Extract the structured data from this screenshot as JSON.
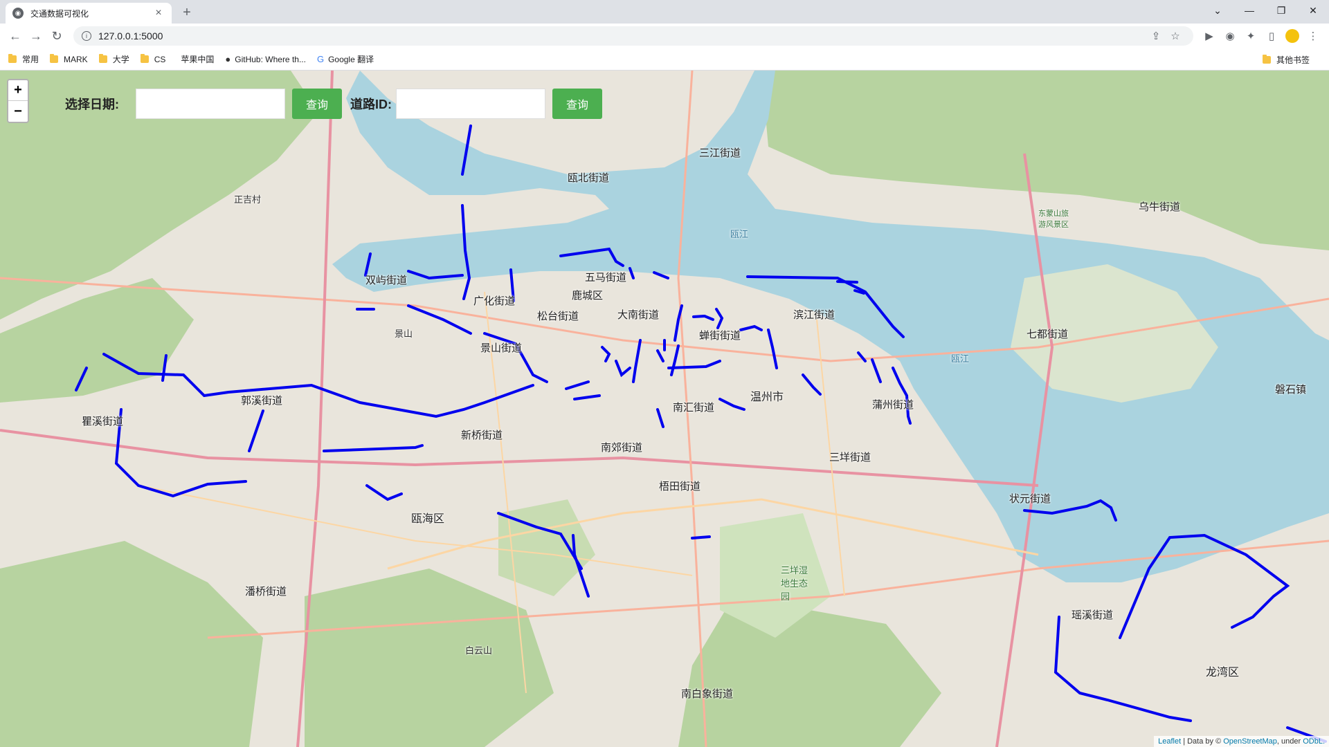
{
  "browser": {
    "tab_title": "交通数据可视化",
    "url": "127.0.0.1:5000",
    "bookmarks": [
      {
        "label": "常用",
        "icon": "folder-icon"
      },
      {
        "label": "MARK",
        "icon": "folder-icon"
      },
      {
        "label": "大学",
        "icon": "folder-icon"
      },
      {
        "label": "CS",
        "icon": "folder-icon"
      },
      {
        "label": "苹果中国",
        "icon": "apple-icon"
      },
      {
        "label": "GitHub: Where th...",
        "icon": "github-icon"
      },
      {
        "label": "Google 翻译",
        "icon": "translate-icon"
      }
    ],
    "other_bookmarks": "其他书签"
  },
  "controls": {
    "date_label": "选择日期:",
    "date_value": "",
    "query_btn_1": "查询",
    "road_label": "道路ID:",
    "road_value": "",
    "query_btn_2": "查询",
    "zoom_in": "+",
    "zoom_out": "−"
  },
  "map": {
    "road_color": "#0000ee",
    "water_color": "#aad3df",
    "labels": {
      "sanjiang": "三江街道",
      "oubei": "瓯北街道",
      "wuniu": "乌牛街道",
      "zhengshu": "正吉村",
      "shuangyu": "双屿街道",
      "guanghua": "广化街道",
      "wuma": "五马街道",
      "lucheng": "鹿城区",
      "binjiang": "滨江街道",
      "qidu": "七都街道",
      "songtai": "松台街道",
      "danan": "大南街道",
      "jingshan": "景山街道",
      "jiushan": "景山",
      "xiexiang": "蝉街街道",
      "wenzhou": "温州市",
      "puzhou": "蒲州街道",
      "panshi": "磐石镇",
      "guoxi": "郭溪街道",
      "quxi": "瞿溪街道",
      "xinqiao": "新桥街道",
      "nanhui": "南汇街道",
      "nanjiao": "南郊街道",
      "sanyang": "三垟街道",
      "zhuangyuan": "状元街道",
      "meitian": "梧田街道",
      "ouhai": "瓯海区",
      "panqiao": "潘桥街道",
      "sanyang_wetland": "三垟湿地生态园",
      "yaoxi": "瑶溪街道",
      "longwan": "龙湾区",
      "baiyun": "白云山",
      "nanbaixiang": "南白象街道",
      "oujiang1": "瓯江",
      "oujiang2": "瓯江",
      "dongmeng": "东蒙山旅游风景区"
    }
  },
  "attribution": {
    "leaflet": "Leaflet",
    "text": "| Data by ©",
    "osm": "OpenStreetMap",
    "under": ", under",
    "odbl": "ODbL."
  }
}
